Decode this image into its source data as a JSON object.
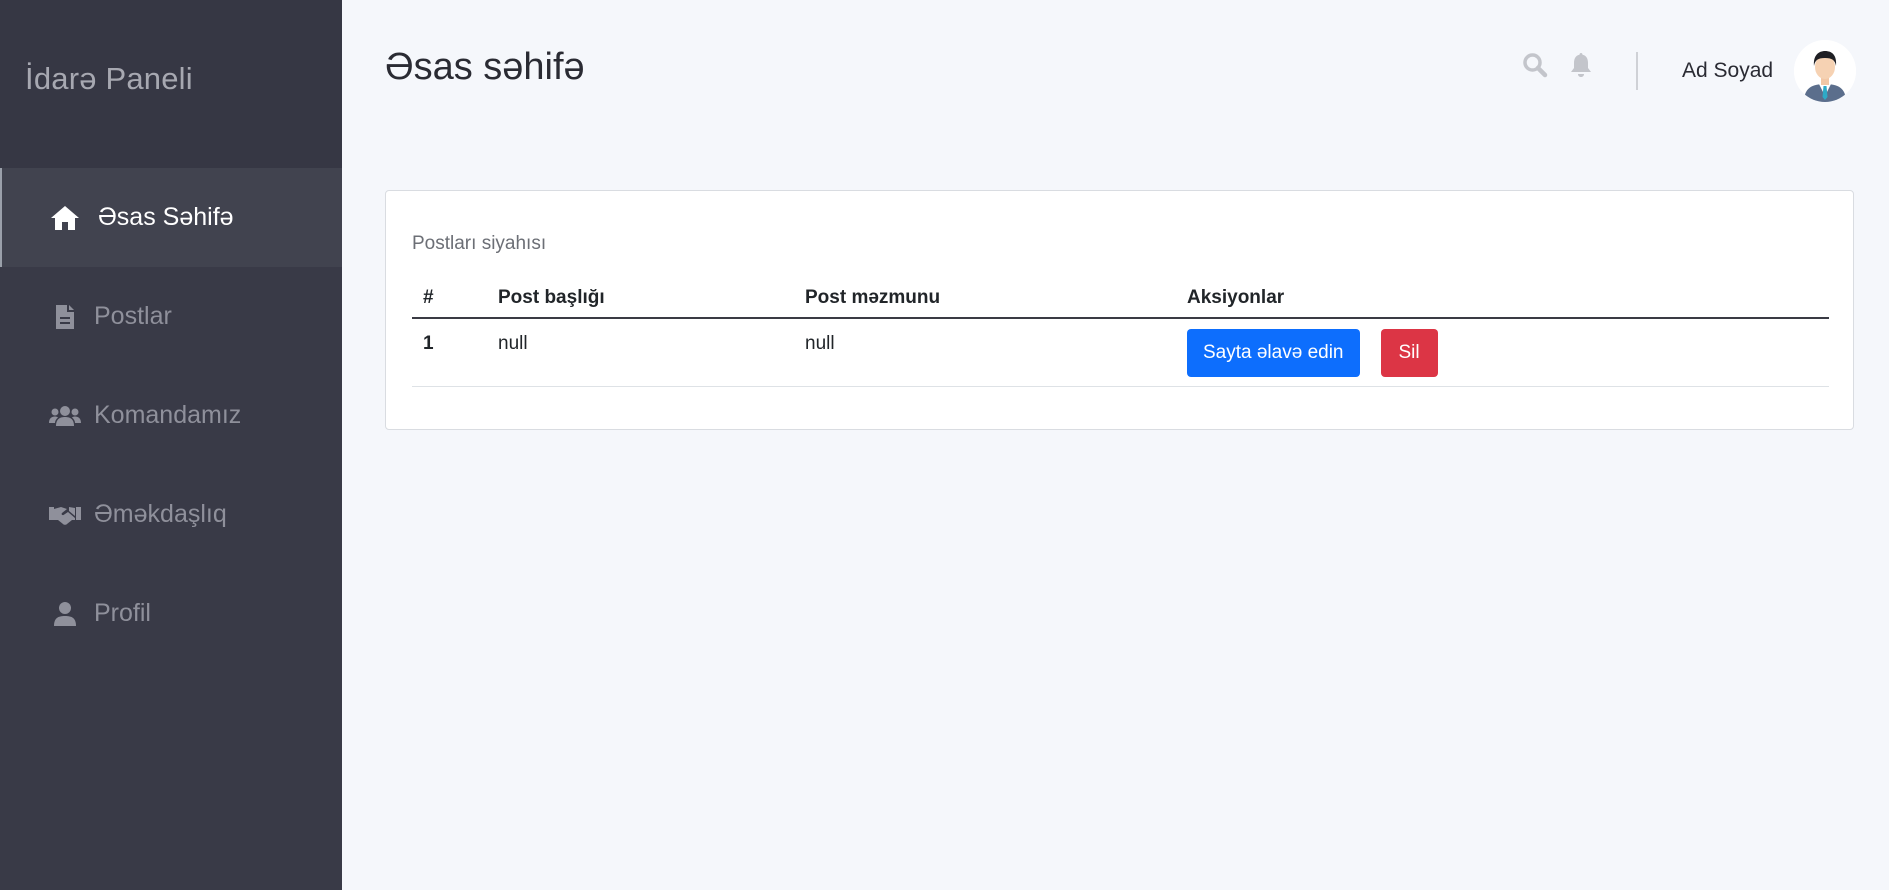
{
  "sidebar": {
    "brand": "İdarə Paneli",
    "items": [
      {
        "label": "Əsas Səhifə",
        "icon": "home-icon",
        "active": true
      },
      {
        "label": "Postlar",
        "icon": "file-icon",
        "active": false
      },
      {
        "label": "Komandamız",
        "icon": "users-icon",
        "active": false
      },
      {
        "label": "Əməkdaşlıq",
        "icon": "handshake-icon",
        "active": false
      },
      {
        "label": "Profil",
        "icon": "user-icon",
        "active": false
      }
    ]
  },
  "header": {
    "title": "Əsas səhifə",
    "user_name": "Ad Soyad",
    "icons": [
      "search-icon",
      "bell-icon"
    ]
  },
  "posts_card": {
    "caption": "Postları siyahısı",
    "columns": [
      "#",
      "Post başlığı",
      "Post məzmunu",
      "Aksiyonlar"
    ],
    "rows": [
      {
        "num": "1",
        "title": "null",
        "content": "null"
      }
    ],
    "add_button_label": "Sayta əlavə edin",
    "delete_button_label": "Sil"
  },
  "colors": {
    "sidebar_bg": "#393a47",
    "primary": "#0d6efd",
    "danger": "#dc3545",
    "page_bg": "#f5f7fb"
  }
}
